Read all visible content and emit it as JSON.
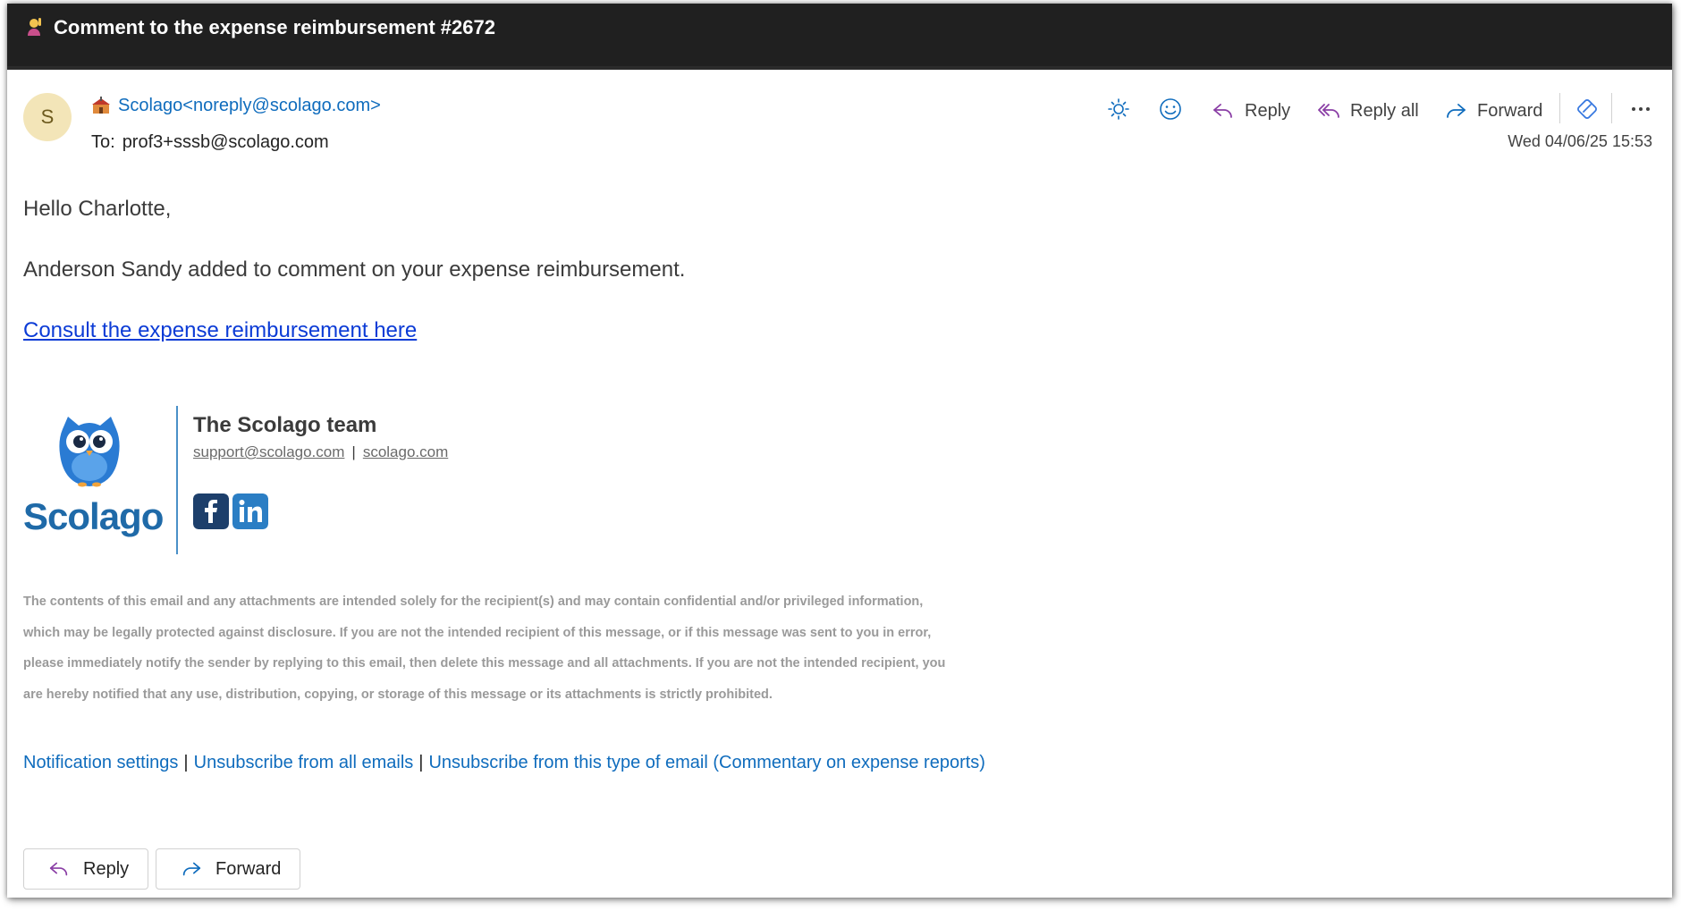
{
  "window": {
    "title": "Comment to the expense reimbursement #2672"
  },
  "message": {
    "avatar_letter": "S",
    "sender_name": "Scolago",
    "sender_email": "<noreply@scolago.com>",
    "to_label": "To:",
    "to_address": "prof3+sssb@scolago.com",
    "date": "Wed 04/06/25 15:53"
  },
  "toolbar": {
    "reply_label": "Reply",
    "reply_all_label": "Reply all",
    "forward_label": "Forward",
    "icons": [
      "brightness-icon",
      "emoji-icon",
      "reply-icon",
      "reply-all-icon",
      "forward-icon",
      "loop-icon",
      "more-icon"
    ]
  },
  "body": {
    "greeting": "Hello Charlotte,",
    "line1": "Anderson Sandy added to comment on your expense reimbursement.",
    "link_text": "Consult the expense reimbursement here"
  },
  "signature": {
    "brand": "Scolago",
    "team": "The Scolago team",
    "support_email": "support@scolago.com",
    "site": "scolago.com",
    "social": [
      "facebook-icon",
      "linkedin-icon"
    ]
  },
  "disclaimer": "The contents of this email and any attachments are intended solely for the recipient(s) and may contain confidential and/or privileged information, which may be legally protected against disclosure. If you are not the intended recipient of this message, or if this message was sent to you in error, please immediately notify the sender by replying to this email, then delete this message and all attachments. If you are not the intended recipient, you are hereby notified that any use, distribution, copying, or storage of this message or its attachments is strictly prohibited.",
  "footer": {
    "notification_settings": "Notification settings",
    "unsubscribe_all": "Unsubscribe from all emails",
    "unsubscribe_type": "Unsubscribe from this type of email (Commentary on expense reports)"
  },
  "bottom_actions": {
    "reply_label": "Reply",
    "forward_label": "Forward"
  },
  "colors": {
    "title_bar": "#202020",
    "link_blue": "#0f6cbd",
    "body_link": "#0b3bd6",
    "reply_purple": "#8a3ea5",
    "brand_blue": "#1f6aa8"
  }
}
